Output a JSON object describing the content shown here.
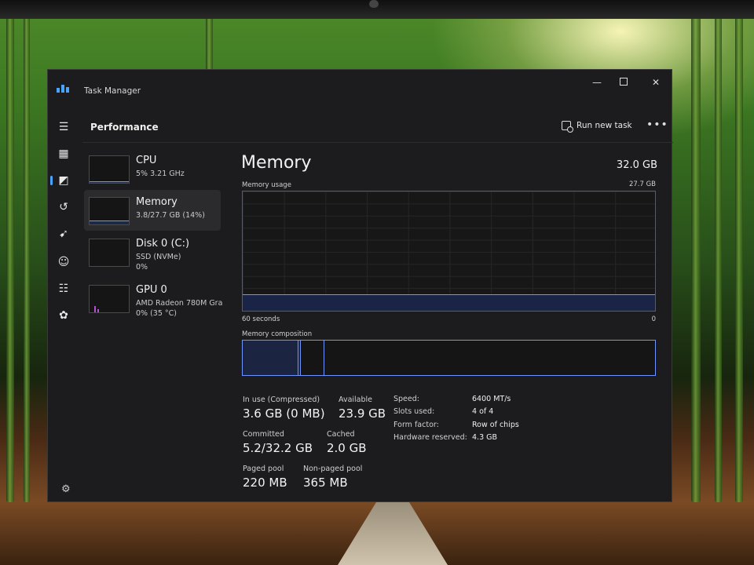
{
  "window": {
    "title": "Task Manager",
    "minimize_glyph": "—",
    "close_glyph": "✕"
  },
  "nav": {
    "items": [
      {
        "icon": "hamburger-menu-icon",
        "glyph": "☰"
      },
      {
        "icon": "processes-icon",
        "glyph": "▦"
      },
      {
        "icon": "performance-icon",
        "glyph": "◩",
        "active": true
      },
      {
        "icon": "app-history-icon",
        "glyph": "↺"
      },
      {
        "icon": "startup-apps-icon",
        "glyph": "➹"
      },
      {
        "icon": "users-icon",
        "glyph": "☺"
      },
      {
        "icon": "details-icon",
        "glyph": "☷"
      },
      {
        "icon": "services-icon",
        "glyph": "✿"
      }
    ],
    "settings_icon": "gear-icon",
    "settings_glyph": "⚙"
  },
  "header": {
    "title": "Performance",
    "run_new_task": "Run new task",
    "more_glyph": "•••"
  },
  "devices": [
    {
      "name": "CPU",
      "line1": "5%  3.21 GHz",
      "line2": "",
      "graph_fill": 0.05
    },
    {
      "name": "Memory",
      "line1": "3.8/27.7 GB (14%)",
      "line2": "",
      "graph_fill": 0.14,
      "selected": true
    },
    {
      "name": "Disk 0 (C:)",
      "line1": "SSD (NVMe)",
      "line2": "0%",
      "graph_fill": 0
    },
    {
      "name": "GPU 0",
      "line1": "AMD Radeon 780M Gra",
      "line2": "0%  (35 °C)",
      "graph_fill": 0
    }
  ],
  "memory": {
    "title": "Memory",
    "total": "32.0 GB",
    "usage_label": "Memory usage",
    "usage_max": "27.7 GB",
    "usage_fraction": 0.14,
    "axis_left": "60 seconds",
    "axis_right": "0",
    "composition_label": "Memory composition",
    "composition": {
      "in_use": 0.135,
      "modified": 0.005,
      "standby": 0.059,
      "free": 0.801
    },
    "stats": {
      "in_use_label": "In use (Compressed)",
      "in_use_value": "3.6 GB (0 MB)",
      "available_label": "Available",
      "available_value": "23.9 GB",
      "committed_label": "Committed",
      "committed_value": "5.2/32.2 GB",
      "cached_label": "Cached",
      "cached_value": "2.0 GB",
      "paged_label": "Paged pool",
      "paged_value": "220 MB",
      "nonpaged_label": "Non-paged pool",
      "nonpaged_value": "365 MB"
    },
    "props": [
      {
        "key": "Speed:",
        "value": "6400 MT/s"
      },
      {
        "key": "Slots used:",
        "value": "4 of 4"
      },
      {
        "key": "Form factor:",
        "value": "Row of chips"
      },
      {
        "key": "Hardware reserved:",
        "value": "4.3 GB"
      }
    ]
  },
  "colors": {
    "accent": "#6f93ff",
    "gpu": "#b54fd4",
    "window_bg": "#1c1c1e"
  }
}
